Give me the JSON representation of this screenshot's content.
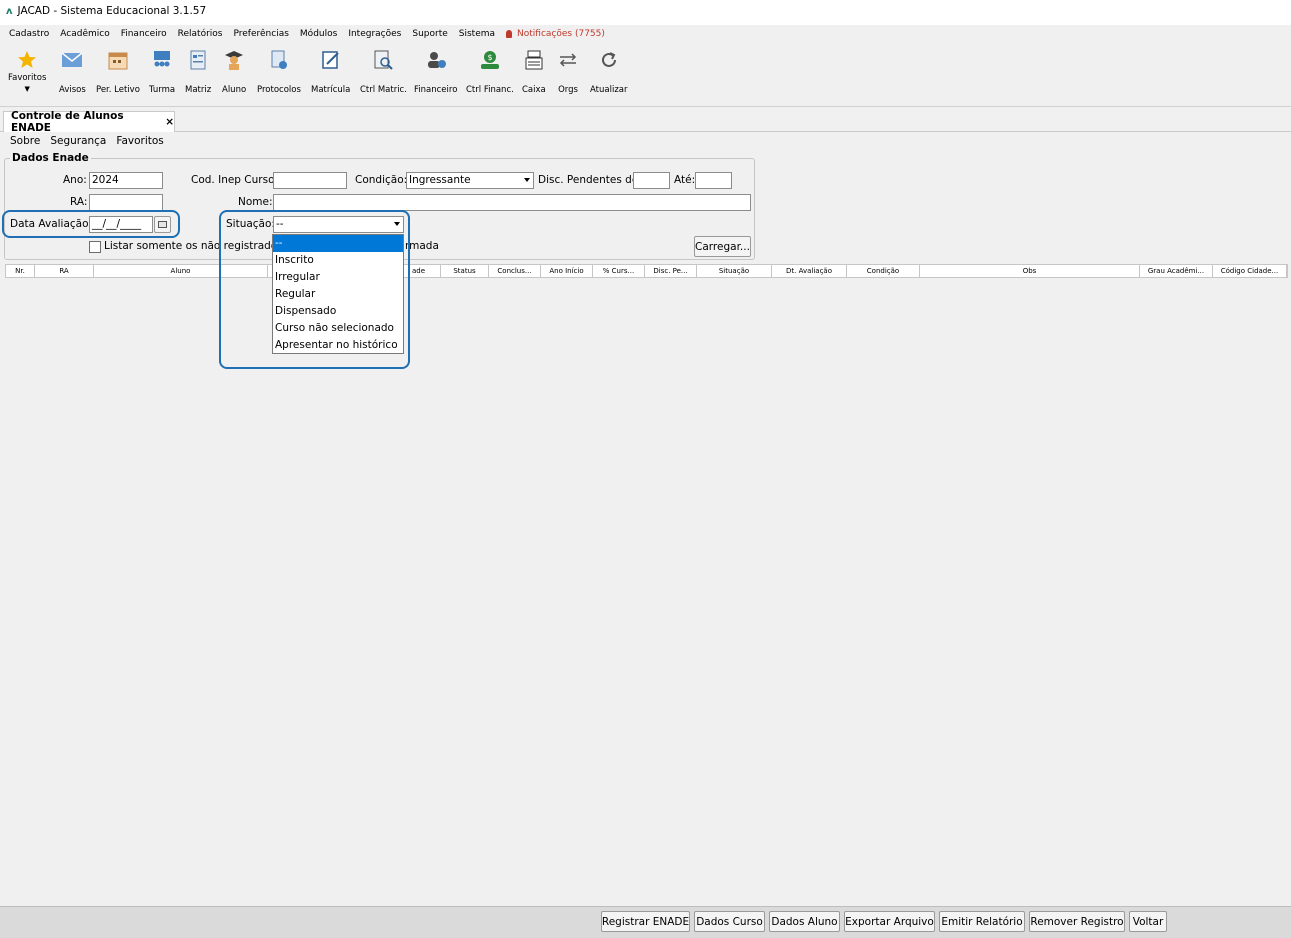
{
  "window": {
    "title": "JACAD - Sistema Educacional 3.1.57"
  },
  "menu": [
    "Cadastro",
    "Acadêmico",
    "Financeiro",
    "Relatórios",
    "Preferências",
    "Módulos",
    "Integrações",
    "Suporte",
    "Sistema"
  ],
  "notifications": "Notificações (7755)",
  "toolbar": {
    "favoritos": "Favoritos",
    "avisos": "Avisos",
    "per_letivo": "Per. Letivo",
    "turma": "Turma",
    "matriz": "Matriz",
    "aluno": "Aluno",
    "protocolos": "Protocolos",
    "matricula": "Matrícula",
    "ctrl_matric": "Ctrl Matric.",
    "financeiro": "Financeiro",
    "ctrl_financ": "Ctrl Financ.",
    "caixa": "Caixa",
    "orgs": "Orgs",
    "atualizar": "Atualizar"
  },
  "tab": {
    "label": "Controle de Alunos ENADE",
    "close": "×"
  },
  "submenu": [
    "Sobre",
    "Segurança",
    "Favoritos"
  ],
  "form": {
    "legend": "Dados Enade",
    "ano_label": "Ano:",
    "ano_value": "2024",
    "cod_inep_label": "Cod. Inep Curso:",
    "cod_inep_value": "",
    "condicao_label": "Condição:",
    "condicao_value": "Ingressante",
    "disc_pend_label": "Disc. Pendentes de:",
    "disc_pend_value": "",
    "ate_label": "Até:",
    "ate_value": "",
    "ra_label": "RA:",
    "ra_value": "",
    "nome_label": "Nome:",
    "nome_value": "",
    "data_aval_label": "Data Avaliação:",
    "data_aval_value": "__/__/____",
    "situacao_label": "Situação:",
    "situacao_value": "--",
    "listar_label": "Listar somente os não registrados",
    "formada_fragment": "rmada",
    "carregar": "Carregar..."
  },
  "situacao_options": [
    "--",
    "Inscrito",
    "Irregular",
    "Regular",
    "Dispensado",
    "Curso não selecionado",
    "Apresentar no histórico"
  ],
  "grid_columns": [
    "Nr.",
    "RA",
    "Aluno",
    "",
    "ade",
    "Status",
    "Conclus...",
    "Ano Início",
    "% Curs...",
    "Disc. Pe...",
    "Situação",
    "Dt. Avaliação",
    "Condição",
    "Obs",
    "Grau Acadêmi...",
    "Código Cidade..."
  ],
  "bottom_buttons": [
    "Registrar ENADE",
    "Dados Curso",
    "Dados Aluno",
    "Exportar Arquivo",
    "Emitir Relatório",
    "Remover Registro",
    "Voltar"
  ],
  "colors": {
    "accent": "#0078d7",
    "highlight": "#1f6fb5"
  }
}
